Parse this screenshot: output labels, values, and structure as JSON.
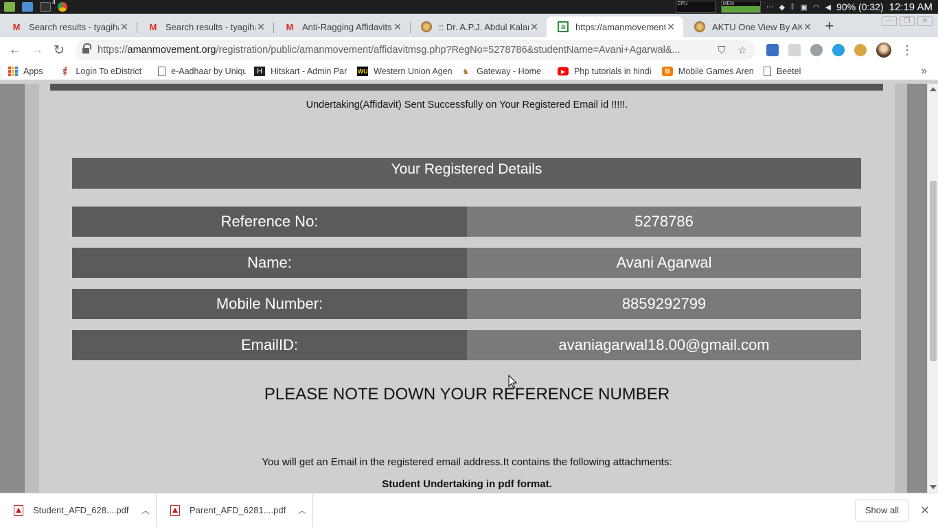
{
  "os": {
    "term_badge": "4",
    "cpu_label": "CPU",
    "mem_label": "MEM",
    "battery": "90% (0:32)",
    "clock": "12:19 AM"
  },
  "tabs": [
    {
      "title": "Search results - tyagihar",
      "icon": "gmail-icon"
    },
    {
      "title": "Search results - tyagihar",
      "icon": "gmail-icon"
    },
    {
      "title": "Anti-Ragging Affidavits -",
      "icon": "gmail-icon"
    },
    {
      "title": ":: Dr. A.P.J. Abdul Kalam T",
      "icon": "seal-icon"
    },
    {
      "title": "https://amanmovement",
      "icon": "amanmovement-icon"
    },
    {
      "title": "AKTU One View By AKTU",
      "icon": "seal-icon"
    }
  ],
  "address": {
    "scheme": "https://",
    "host": "amanmovement.org",
    "path": "/registration/public/amanmovement/affidavitmsg.php?RegNo=5278786&studentName=Avani+Agarwal&..."
  },
  "bookmarks": [
    {
      "label": "Apps",
      "icon": "apps-icon"
    },
    {
      "label": "Login To eDistrict",
      "icon": "edistrict-icon"
    },
    {
      "label": "e-Aadhaar by Uniqu",
      "icon": "document-icon"
    },
    {
      "label": "Hitskart - Admin Par",
      "icon": "hitskart-icon"
    },
    {
      "label": "Western Union Agen",
      "icon": "western-union-icon"
    },
    {
      "label": "Gateway - Home",
      "icon": "gateway-icon"
    },
    {
      "label": "Php tutorials in hindi",
      "icon": "youtube-icon"
    },
    {
      "label": "Mobile Games Aren",
      "icon": "blogger-icon"
    },
    {
      "label": "Beetel",
      "icon": "document-icon"
    }
  ],
  "page": {
    "success_message": "Undertaking(Affidavit) Sent Successfully on Your Registered Email id !!!!!.",
    "details_heading": "Your Registered Details",
    "details": [
      {
        "label": "Reference No:",
        "value": "5278786"
      },
      {
        "label": "Name:",
        "value": "Avani Agarwal"
      },
      {
        "label": "Mobile Number:",
        "value": "8859292799"
      },
      {
        "label": "EmailID:",
        "value": "avaniagarwal18.00@gmail.com"
      }
    ],
    "note": "PLEASE NOTE DOWN YOUR REFERENCE NUMBER",
    "email_info": "You will get an Email in the registered email address.It contains the following attachments:",
    "attachment": "Student Undertaking in pdf format."
  },
  "downloads": {
    "items": [
      {
        "name": "Student_AFD_628....pdf"
      },
      {
        "name": "Parent_AFD_6281....pdf"
      }
    ],
    "show_all": "Show all"
  },
  "colors": {
    "details_label_bg": "#5b5b5b",
    "details_value_bg": "#7a7a7a",
    "page_bg": "#cfcfcf"
  }
}
